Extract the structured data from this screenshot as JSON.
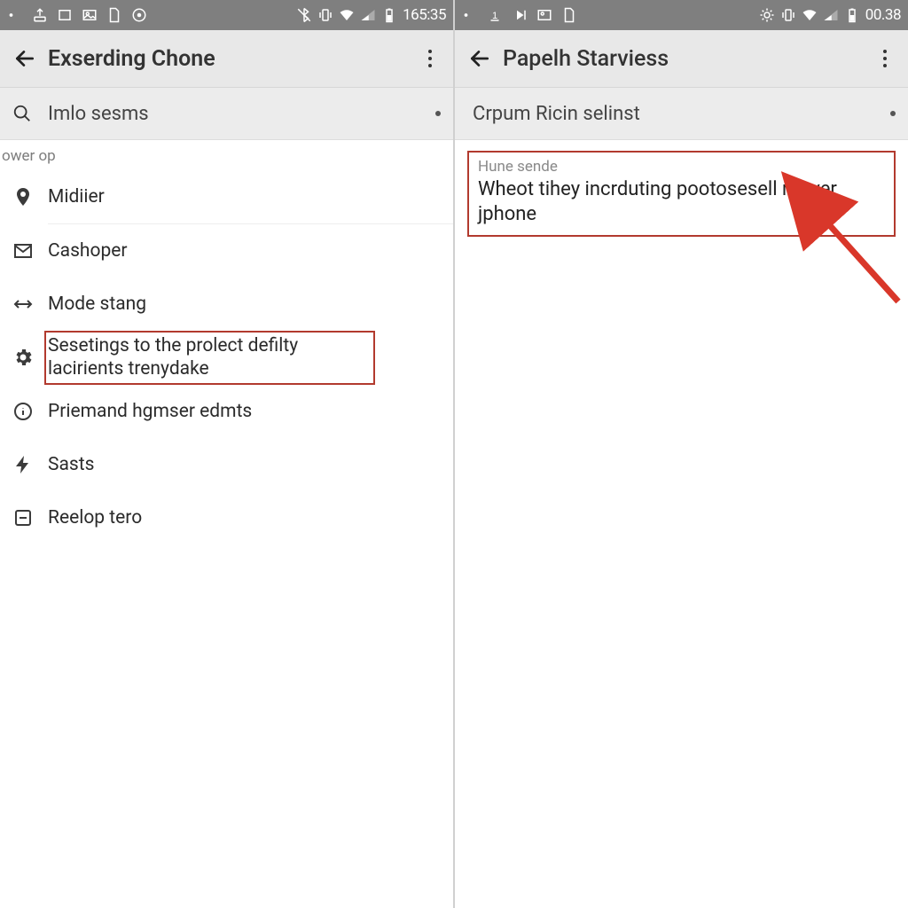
{
  "status": {
    "left_time": "165:35",
    "right_time": "00.38"
  },
  "left": {
    "title": "Exserding Chone",
    "search_placeholder": "Imlo sesms",
    "section_caption": "ower op",
    "items": [
      {
        "icon": "pin",
        "label": "Midiier"
      },
      {
        "icon": "mail",
        "label": "Cashoper"
      },
      {
        "icon": "swap",
        "label": "Mode stang"
      },
      {
        "icon": "gear",
        "label": "Sesetings to the prolect defilty lacirients trenydake",
        "highlight": true
      },
      {
        "icon": "info",
        "label": "Priemand hgmser edmts"
      },
      {
        "icon": "bolt",
        "label": "Sasts"
      },
      {
        "icon": "square",
        "label": "Reelop tero"
      }
    ]
  },
  "right": {
    "title": "Papelh Starviess",
    "subtitle": "Crpum Ricin selinst",
    "card_title": "Hune sende",
    "card_body": "Wheot tihey incrduting pootosesell ngrver jphone"
  }
}
